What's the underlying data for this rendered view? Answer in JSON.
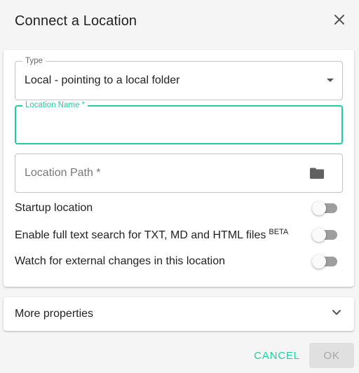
{
  "dialog": {
    "title": "Connect a Location",
    "close_icon": "close-icon"
  },
  "form": {
    "type_field": {
      "label": "Type",
      "value": "Local - pointing to a local folder",
      "icon": "dropdown-arrow-icon"
    },
    "location_name_field": {
      "label": "Location Name *",
      "value": "",
      "focused": true
    },
    "location_path_field": {
      "placeholder": "Location Path *",
      "value": "",
      "icon": "folder-icon"
    },
    "toggles": [
      {
        "label": "Startup location",
        "badge": "",
        "checked": false
      },
      {
        "label": "Enable full text search for TXT, MD and HTML files",
        "badge": "BETA",
        "checked": false
      },
      {
        "label": "Watch for external changes in this location",
        "badge": "",
        "checked": false
      }
    ]
  },
  "more_properties": {
    "label": "More properties",
    "icon": "chevron-down-icon"
  },
  "actions": {
    "cancel_label": "CANCEL",
    "ok_label": "OK",
    "ok_disabled": true
  },
  "colors": {
    "accent": "#1dd19f",
    "background": "#f5f5f5",
    "card": "#ffffff",
    "switch_track_off": "#9e9e9e",
    "disabled_button": "#e0e0e0"
  }
}
